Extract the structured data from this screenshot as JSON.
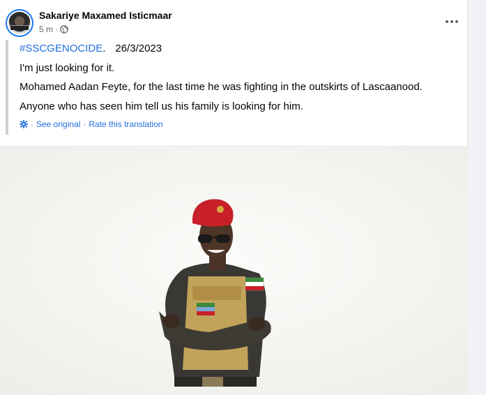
{
  "post": {
    "author": "Sakariye Maxamed Isticmaar",
    "time": "5 m",
    "separator": "·",
    "hashtag": "#SSCGENOCIDE",
    "hashtag_suffix": ".",
    "date": "26/3/2023",
    "line1": "I'm just looking for it.",
    "line2": "Mohamed Aadan Feyte, for the last time he was fighting in the outskirts of Lascaanood.",
    "line3": "Anyone who has seen him tell us his family is looking for him.",
    "see_original": "See original",
    "rate_translation": "Rate this translation"
  },
  "icons": {
    "globe": "globe-icon",
    "more": "more-options-icon",
    "settings": "gear-icon"
  },
  "colors": {
    "link": "#216fdb",
    "avatar_ring": "#1877f2",
    "beret": "#c8202a",
    "uniform": "#c2a35a"
  }
}
